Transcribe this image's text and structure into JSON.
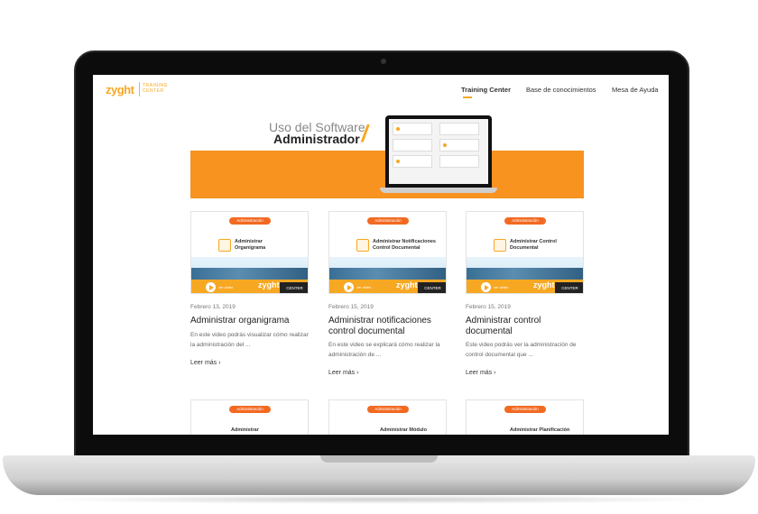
{
  "logo": {
    "brand": "zyght",
    "sub_line1": "TRAINING",
    "sub_line2": "CENTER"
  },
  "nav": [
    {
      "label": "Training Center",
      "active": true
    },
    {
      "label": "Base de conocimientos",
      "active": false
    },
    {
      "label": "Mesa de Ayuda",
      "active": false
    }
  ],
  "hero": {
    "line1": "Uso del Software",
    "line2": "Administrador",
    "accent_color": "#f7931e"
  },
  "cards": [
    {
      "badge": "Administración",
      "thumb_title": "Administrar Organigrama",
      "date": "Febrero 13, 2019",
      "title": "Administrar organigrama",
      "desc": "En este video podrás visualizar cómo realizar la administración del ...",
      "more": "Leer más"
    },
    {
      "badge": "Administración",
      "thumb_title": "Administrar Notificaciones Control Documental",
      "date": "Febrero 15, 2019",
      "title": "Administrar notificaciones control documental",
      "desc": "En este video se explicará cómo realizar la administración de ...",
      "more": "Leer más"
    },
    {
      "badge": "Administración",
      "thumb_title": "Administrar Control Documental",
      "date": "Febrero 15, 2019",
      "title": "Administrar control documental",
      "desc": "Este video podrás ver la administración de control documental que ...",
      "more": "Leer más"
    }
  ],
  "cards_row2": [
    {
      "badge": "Administración",
      "thumb_title": "Administrar"
    },
    {
      "badge": "Administración",
      "thumb_title": "Administrar Módulo"
    },
    {
      "badge": "Administración",
      "thumb_title": "Administrar Planificación"
    }
  ],
  "thumb_strip": {
    "play_label": "ver video",
    "logo": "zyght",
    "center": "CENTER"
  }
}
